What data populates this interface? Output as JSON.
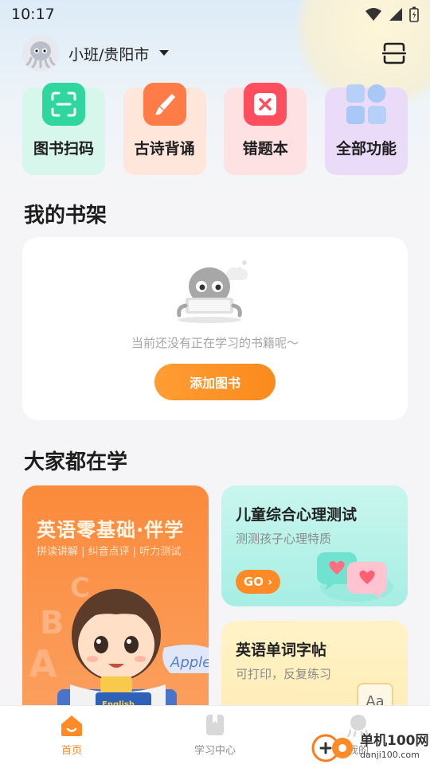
{
  "status_bar": {
    "time": "10:17"
  },
  "header": {
    "location": "小班/贵阳市"
  },
  "quick_actions": [
    {
      "label": "图书扫码",
      "icon": "scan-book-icon",
      "bg": "#d7f7ec",
      "icon_color": "#2fd69e"
    },
    {
      "label": "古诗背诵",
      "icon": "brush-icon",
      "bg": "#ffe6da",
      "icon_color": "#ff7b48"
    },
    {
      "label": "错题本",
      "icon": "wrong-x-icon",
      "bg": "#fde1e3",
      "icon_color": "#ff4f5e"
    },
    {
      "label": "全部功能",
      "icon": "grid-apps-icon",
      "bg": "#eadcf8",
      "icon_color": "#a8c8f5"
    }
  ],
  "bookshelf": {
    "title": "我的书架",
    "empty_text": "当前还没有正在学习的书籍呢～",
    "add_button": "添加图书"
  },
  "popular": {
    "title": "大家都在学",
    "big_card": {
      "title": "英语零基础·伴学",
      "subtitle": "拼读讲解 | 纠音点评 | 听力测试",
      "book_text": "English",
      "apple_text": "Apple"
    },
    "card_psych": {
      "title": "儿童综合心理测试",
      "subtitle": "测测孩子心理特质",
      "go_label": "GO ›"
    },
    "card_words": {
      "title": "英语单词字帖",
      "subtitle": "可打印，反复练习",
      "badge": "Aa"
    }
  },
  "tab_bar": {
    "tabs": [
      {
        "label": "首页",
        "icon": "home-icon",
        "active": true
      },
      {
        "label": "学习中心",
        "icon": "book-icon",
        "active": false
      },
      {
        "label": "我的",
        "icon": "profile-icon",
        "active": false
      }
    ]
  },
  "watermark": {
    "main": "单机100网",
    "sub": "danji100.com"
  },
  "colors": {
    "accent": "#ff8a26",
    "page_bg": "#f5f5f7"
  }
}
